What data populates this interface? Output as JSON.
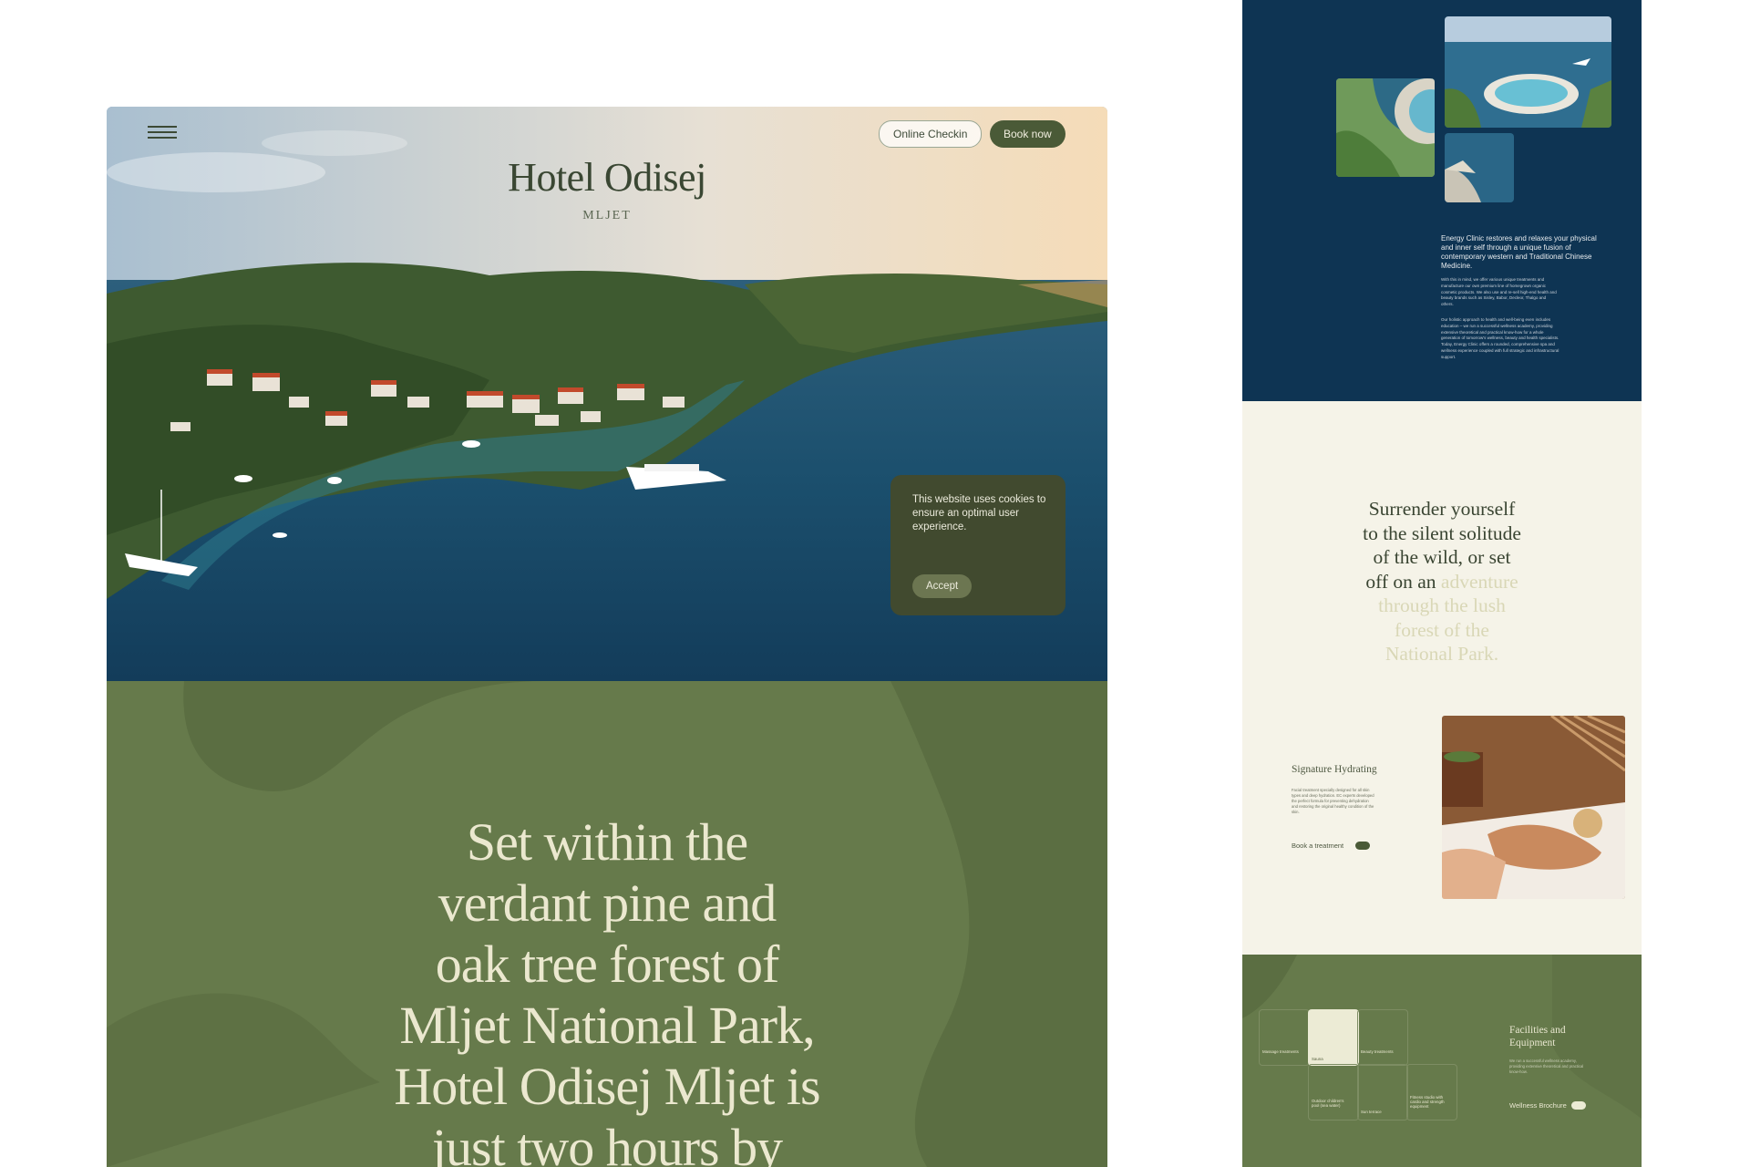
{
  "hero": {
    "hotel_name": "Hotel Odisej",
    "location": "MLJET",
    "online_checkin_label": "Online Checkin",
    "book_now_label": "Book now"
  },
  "cookie": {
    "message": "This website uses cookies to ensure an optimal user experience.",
    "accept_label": "Accept"
  },
  "intro": {
    "lines": [
      "Set within the",
      "verdant pine and",
      "oak tree forest of",
      "Mljet National Park,",
      "Hotel Odisej Mljet is",
      "just two hours by"
    ]
  },
  "clinic": {
    "lead": "Energy Clinic restores and relaxes your physical and inner self through a unique fusion of contemporary western and Traditional Chinese Medicine.",
    "body_1": "With this in mind, we offer various unique treatments and manufacture our own premium line of homegrown organic cosmetic products. We also use and re-sell high-end health and beauty brands such as Sisley, Babor, Decleor, Thalgo and others.",
    "body_2": "Our holistic approach to health and well-being even includes education – we run a successful wellness academy, providing extensive theoretical and practical know-how for a whole generation of tomorrow's wellness, beauty and health specialists. Today, Energy Clinic offers a rounded, comprehensive spa and wellness experience coupled with full strategic and infrastructural support."
  },
  "quote": {
    "lines_dark": [
      "Surrender yourself",
      "to the silent solitude",
      "of the wild, or set",
      "off on an"
    ],
    "inline_muted": "adventure",
    "lines_muted": [
      "through the lush",
      "forest of the",
      "National Park."
    ]
  },
  "signature": {
    "title": "Signature Hydrating",
    "body": "Facial treatment specially designed for all skin types and deep hydration. EC experts developed the perfect formula for preventing dehydration and restoring the original healthy condition of the skin.",
    "link_label": "Book a treatment"
  },
  "facilities": {
    "title": "Facilities and Equipment",
    "body": "We run a successful wellness academy, providing extensive theoretical and practical know-how.",
    "link_label": "Wellness Brochure",
    "cells": [
      "Massage treatments",
      "Sauna",
      "Beauty treatments",
      "Outdoor children's pool (sea water)",
      "Sun terrace",
      "Fitness studio with cardio and strength equipment"
    ]
  }
}
